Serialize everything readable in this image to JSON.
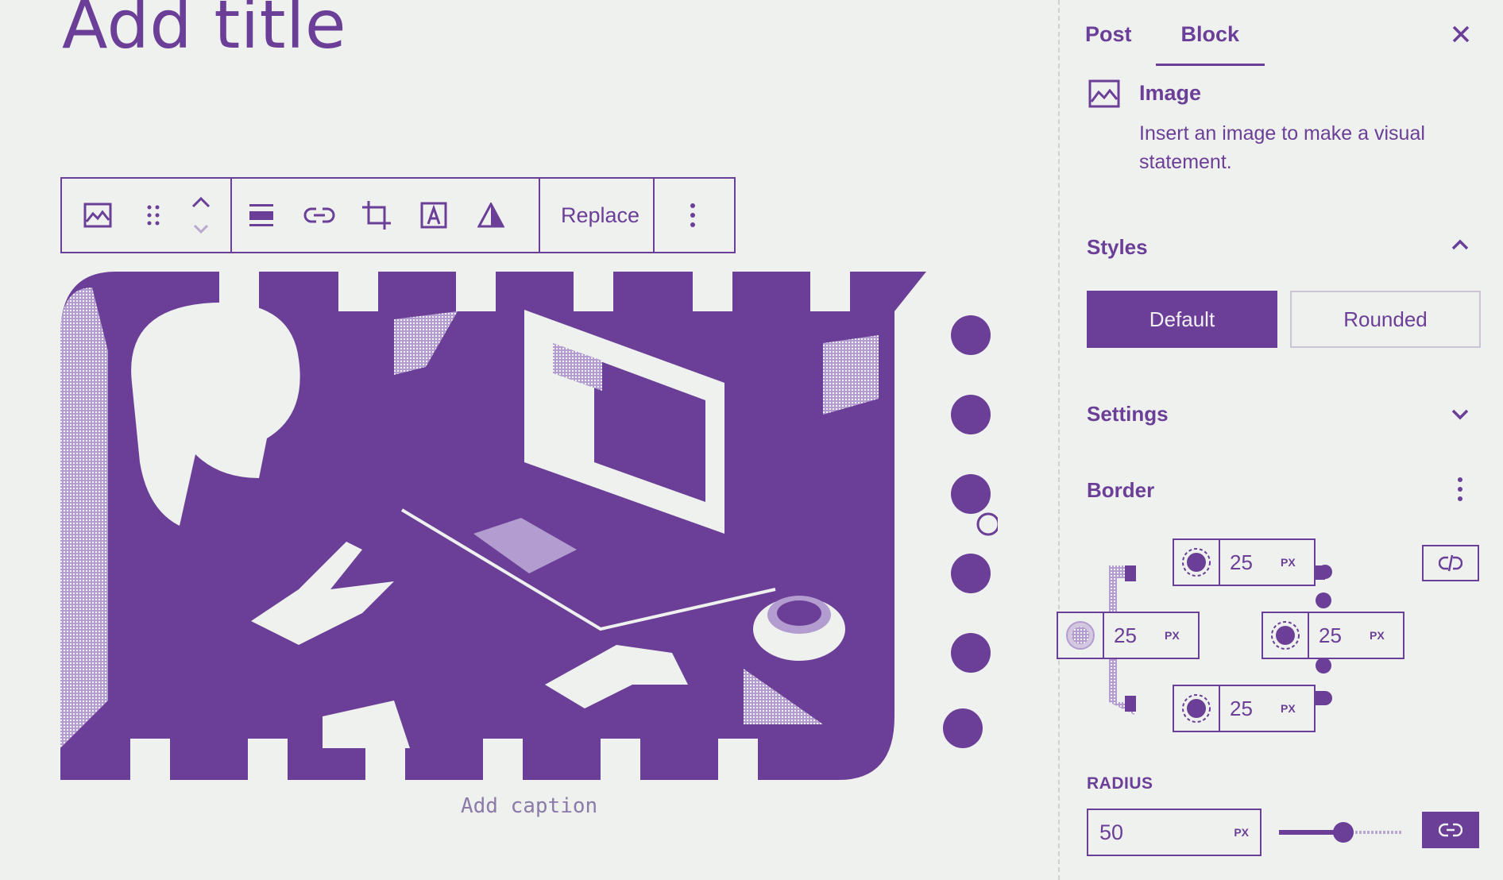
{
  "editor": {
    "title_placeholder": "Add title",
    "caption_placeholder": "Add caption"
  },
  "toolbar": {
    "items": [
      {
        "name": "image-block-icon"
      },
      {
        "name": "drag-handle-icon"
      },
      {
        "name": "move-up-down-icon"
      },
      {
        "name": "align-icon"
      },
      {
        "name": "link-icon"
      },
      {
        "name": "crop-icon"
      },
      {
        "name": "text-overlay-icon"
      },
      {
        "name": "duotone-filter-icon"
      }
    ],
    "replace_label": "Replace",
    "more_icon": "more-vertical-icon"
  },
  "sidebar": {
    "tabs": [
      {
        "label": "Post",
        "active": false
      },
      {
        "label": "Block",
        "active": true
      }
    ],
    "close_icon": "close-icon",
    "block": {
      "icon": "image-icon",
      "name": "Image",
      "description": "Insert an image to make a visual statement."
    },
    "styles": {
      "heading": "Styles",
      "expanded": true,
      "options": [
        {
          "label": "Default",
          "selected": true
        },
        {
          "label": "Rounded",
          "selected": false
        }
      ]
    },
    "settings": {
      "heading": "Settings",
      "expanded": false
    },
    "border": {
      "heading": "Border",
      "top": {
        "value": "25",
        "unit": "PX"
      },
      "left": {
        "value": "25",
        "unit": "PX"
      },
      "right": {
        "value": "25",
        "unit": "PX"
      },
      "bottom": {
        "value": "25",
        "unit": "PX"
      },
      "link_icon": "unlink-icon"
    },
    "radius": {
      "label": "RADIUS",
      "value": "50",
      "unit": "PX",
      "slider_fraction": 0.52,
      "link_icon": "link-icon"
    }
  },
  "colors": {
    "accent": "#6b3f97",
    "background": "#eef1ee",
    "muted": "#8c7aa8"
  }
}
